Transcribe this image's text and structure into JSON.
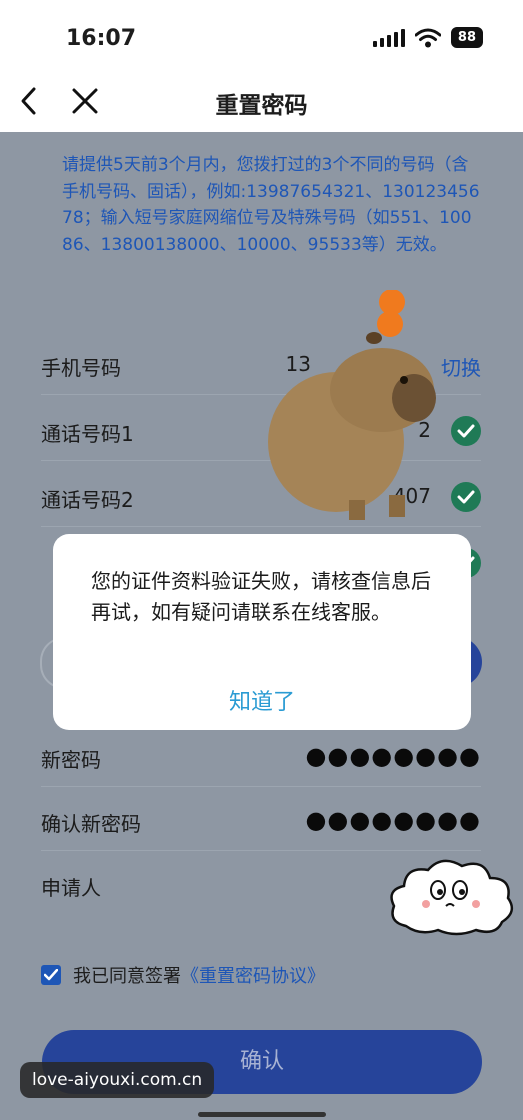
{
  "status_bar": {
    "time": "16:07",
    "battery": "88"
  },
  "nav": {
    "title": "重置密码",
    "back_icon": "chevron-left-icon",
    "close_icon": "close-icon"
  },
  "notice": "请提供5天前3个月内，您拨打过的3个不同的号码（含手机号码、固话），例如:13987654321、13012345678；输入短号家庭网缩位号及特殊号码（如551、10086、13800138000、10000、95533等）无效。",
  "form": {
    "phone_label": "手机号码",
    "phone_value": "13",
    "switch_label": "切换",
    "call1_label": "通话号码1",
    "call1_value": "2",
    "call2_label": "通话号码2",
    "call2_value": "407",
    "new_pwd_label": "新密码",
    "new_pwd_value": "●●●●●●●●",
    "confirm_pwd_label": "确认新密码",
    "confirm_pwd_value": "●●●●●●●●",
    "applicant_label": "申请人"
  },
  "agreement": {
    "text": "我已同意签署",
    "link": "《重置密码协议》",
    "checked": true
  },
  "confirm_button": "确认",
  "dialog": {
    "message": "您的证件资料验证失败，请核查信息后再试，如有疑问请联系在线客服。",
    "button": "知道了"
  },
  "watermark": "love-aiyouxi.com.cn",
  "colors": {
    "accent": "#1e56b6",
    "dialog_button": "#2a9bd3",
    "check": "#1f7a56"
  }
}
